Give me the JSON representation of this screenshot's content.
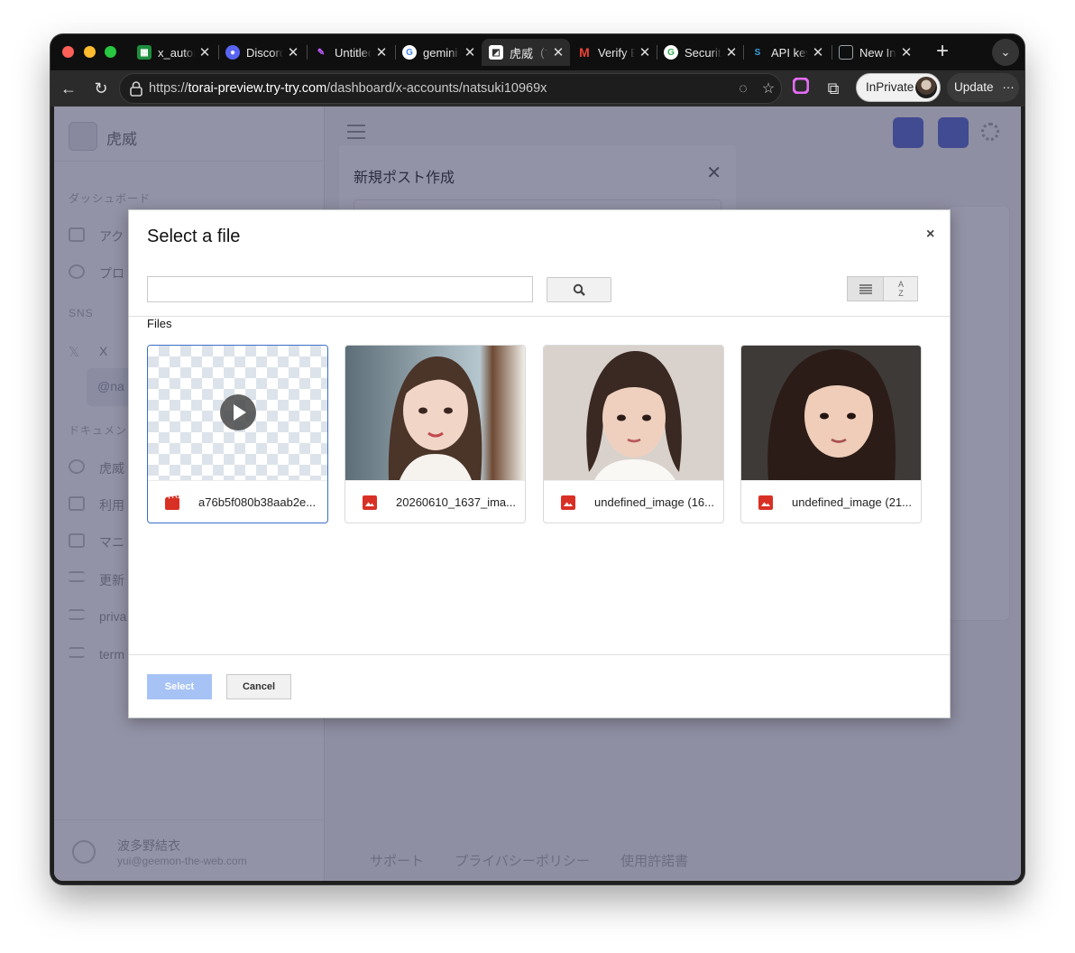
{
  "browser": {
    "tabs": [
      {
        "title": "x_autom",
        "favicon": "sheets-icon",
        "color": "#1e8e3e"
      },
      {
        "title": "Discord",
        "favicon": "discord-icon",
        "color": "#5865f2"
      },
      {
        "title": "Untitled",
        "favicon": "tool-icon",
        "color": "#7a4bd6"
      },
      {
        "title": "gemini",
        "favicon": "google-icon",
        "color": "#4285f4"
      },
      {
        "title": "虎威（T",
        "favicon": "torai-icon",
        "color": "#ffffff"
      },
      {
        "title": "Verify E",
        "favicon": "gmail-icon",
        "color": "#ea4335"
      },
      {
        "title": "Securit",
        "favicon": "google-icon",
        "color": "#34a853"
      },
      {
        "title": "API key",
        "favicon": "api-icon",
        "color": "#3aa3e3"
      },
      {
        "title": "New In",
        "favicon": "page-icon",
        "color": "#9aa0a6"
      }
    ],
    "url_prefix": "https://",
    "url_host": "torai-preview.try-try.com",
    "url_path": "/dashboard/x-accounts/natsuki10969x",
    "inprivate_label": "InPrivate",
    "update_label": "Update"
  },
  "app": {
    "brand": "虎威",
    "sections": [
      "ダッシュボード",
      "SNS",
      "ドキュメント"
    ],
    "nav_items": [
      "アク",
      "プロ",
      "X",
      "虎威",
      "利用",
      "マニ",
      "更新",
      "priva",
      "term"
    ],
    "account_chip": "@na",
    "user_name": "波多野結衣",
    "user_email": "yui@geemon-the-web.com",
    "footer_links": [
      "サポート",
      "プライバシーポリシー",
      "使用許諾書"
    ]
  },
  "compose_modal": {
    "title": "新規ポスト作成",
    "close_icon": "close-icon"
  },
  "file_picker": {
    "title": "Select a file",
    "close_label": "×",
    "search_value": "",
    "search_placeholder": "",
    "section_label": "Files",
    "select_label": "Select",
    "cancel_label": "Cancel",
    "files": [
      {
        "name": "a76b5f080b38aab2e...",
        "type": "video",
        "icon": "video-file-icon",
        "selected": true
      },
      {
        "name": "20260610_1637_ima...",
        "type": "image",
        "icon": "image-file-icon",
        "selected": false
      },
      {
        "name": "undefined_image (16...",
        "type": "image",
        "icon": "image-file-icon",
        "selected": false
      },
      {
        "name": "undefined_image (21...",
        "type": "image",
        "icon": "image-file-icon",
        "selected": false
      }
    ]
  },
  "colors": {
    "accent": "#3b6ec8",
    "select_button_disabled": "#a7c3f5",
    "file_icon_red": "#d93025"
  }
}
